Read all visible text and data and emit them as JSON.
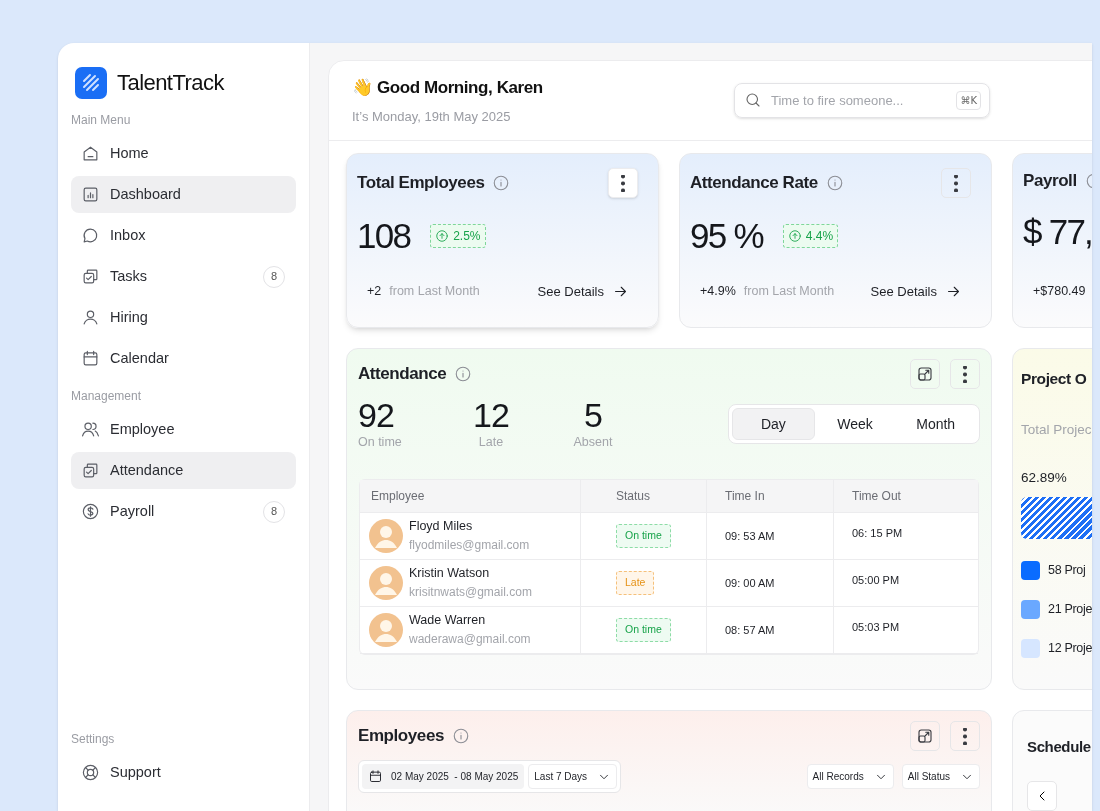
{
  "app": {
    "name": "TalentTrack"
  },
  "sidebar": {
    "sections": [
      {
        "title": "Main Menu",
        "items": [
          {
            "label": "Home",
            "selected": false
          },
          {
            "label": "Dashboard",
            "selected": true
          },
          {
            "label": "Inbox",
            "selected": false
          },
          {
            "label": "Tasks",
            "selected": false,
            "badge": "8"
          },
          {
            "label": "Hiring",
            "selected": false
          },
          {
            "label": "Calendar",
            "selected": false
          }
        ]
      },
      {
        "title": "Management",
        "items": [
          {
            "label": "Employee",
            "selected": false
          },
          {
            "label": "Attendance",
            "selected": true
          },
          {
            "label": "Payroll",
            "selected": false,
            "badge": "8"
          }
        ]
      },
      {
        "title": "Settings",
        "items": [
          {
            "label": "Support",
            "selected": false
          }
        ]
      }
    ]
  },
  "header": {
    "greeting": "Good Morning, Karen",
    "emoji": "👋",
    "date": "It’s Monday, 19th May 2025",
    "search": {
      "placeholder": "Time to fire someone...",
      "shortcut": "⌘K"
    }
  },
  "stat_cards": [
    {
      "title": "Total Employees",
      "value": "108",
      "change": "2.5%",
      "delta": "+2",
      "delta_label": "from Last Month",
      "link": "See Details",
      "focused": true
    },
    {
      "title": "Attendance Rate",
      "value": "95 %",
      "change": "4.4%",
      "delta": "+4.9%",
      "delta_label": "from Last Month",
      "link": "See Details",
      "focused": false
    },
    {
      "title": "Payroll",
      "value": "$ 77,",
      "delta": "+$780.49",
      "focused": false
    }
  ],
  "attendance": {
    "title": "Attendance",
    "stats": [
      {
        "value": "92",
        "label": "On time"
      },
      {
        "value": "12",
        "label": "Late"
      },
      {
        "value": "5",
        "label": "Absent"
      }
    ],
    "periods": [
      {
        "label": "Day",
        "selected": true
      },
      {
        "label": "Week",
        "selected": false
      },
      {
        "label": "Month",
        "selected": false
      }
    ],
    "table": {
      "columns": [
        "Employee",
        "Status",
        "Time In",
        "Time Out"
      ],
      "rows": [
        {
          "name": "Floyd Miles",
          "email": "flyodmiles@gmail.com",
          "status": {
            "text": "On time",
            "kind": "on_time"
          },
          "time_in": "09: 53 AM",
          "time_out": "06: 15 PM"
        },
        {
          "name": "Kristin Watson",
          "email": "krisitnwats@gmail.com",
          "status": {
            "text": "Late",
            "kind": "late"
          },
          "time_in": "09: 00 AM",
          "time_out": "05:00 PM"
        },
        {
          "name": "Wade Warren",
          "email": "waderawa@gmail.com",
          "status": {
            "text": "On time",
            "kind": "on_time"
          },
          "time_in": "08: 57 AM",
          "time_out": "05:03 PM"
        }
      ]
    }
  },
  "project_overview": {
    "title": "Project O",
    "subtitle": "Total Projec",
    "percent": "62.89%",
    "legend": [
      {
        "label": "58 Proj",
        "color": "#0a6cff"
      },
      {
        "label": "21 Proje",
        "color": "#6aa8ff"
      },
      {
        "label": "12 Proje",
        "color": "#d6e6ff"
      }
    ]
  },
  "employees": {
    "title": "Employees",
    "date_range": "02 May 2025  - 08 May 2025",
    "range_select": "Last 7 Days",
    "filters": [
      "All Records",
      "All Status"
    ]
  },
  "schedule": {
    "title": "Schedule"
  }
}
